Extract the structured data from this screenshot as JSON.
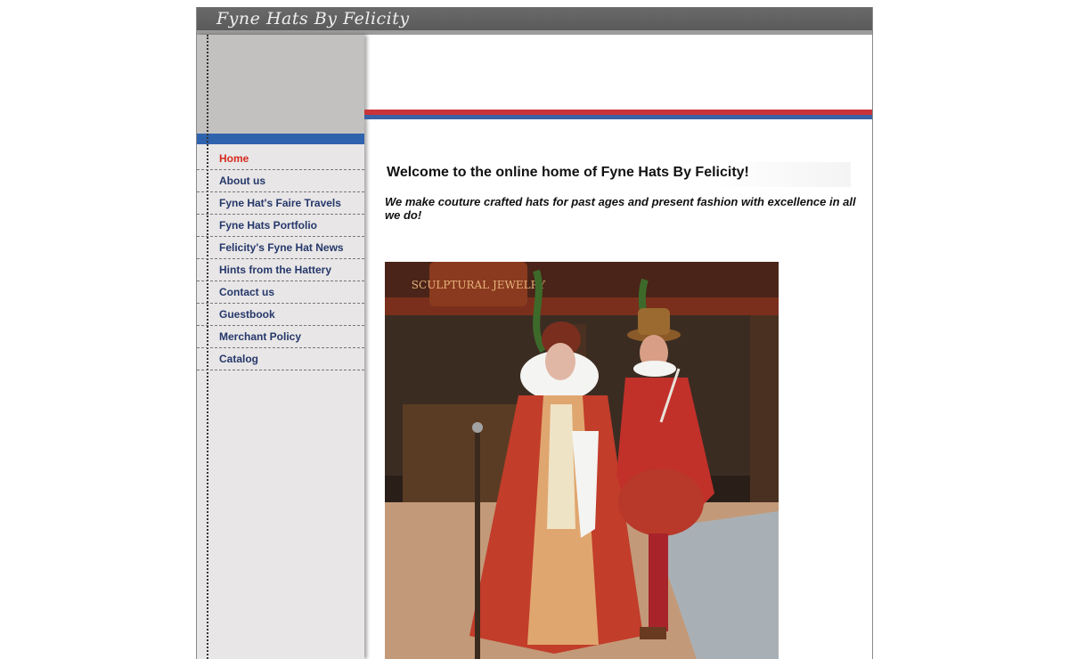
{
  "header": {
    "site_title": "Fyne Hats By Felicity"
  },
  "sidebar": {
    "items": [
      {
        "label": "Home",
        "active": true
      },
      {
        "label": "About us",
        "active": false
      },
      {
        "label": "Fyne Hat's Faire Travels",
        "active": false
      },
      {
        "label": "Fyne Hats Portfolio",
        "active": false
      },
      {
        "label": "Felicity's Fyne Hat News",
        "active": false
      },
      {
        "label": "Hints from the Hattery",
        "active": false
      },
      {
        "label": "Contact us",
        "active": false
      },
      {
        "label": "Guestbook",
        "active": false
      },
      {
        "label": "Merchant Policy",
        "active": false
      },
      {
        "label": "Catalog",
        "active": false
      }
    ]
  },
  "main": {
    "welcome": "Welcome to the online home of Fyne Hats By Felicity!",
    "tagline": "We make couture crafted hats for past ages and present fashion with excellence in all we do!",
    "photo_sign_text": "SCULPTURAL JEWELRY"
  },
  "colors": {
    "header_bg": "#5e5e5e",
    "nav_text": "#25386b",
    "nav_active": "#d62a20",
    "stripe_red": "#c8343a",
    "stripe_blue": "#3b61a6",
    "sidebar_bg": "#e8e6e6"
  }
}
